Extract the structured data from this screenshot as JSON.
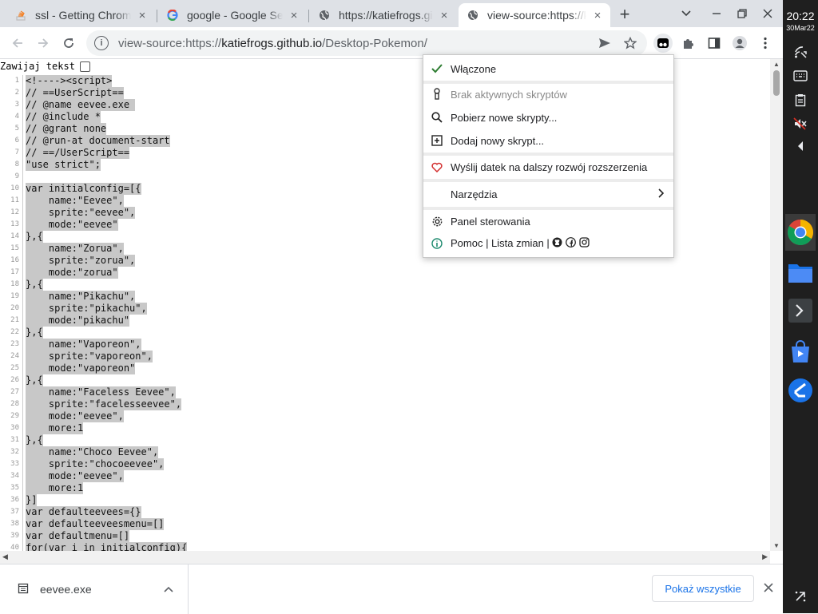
{
  "tabs": [
    {
      "title": "ssl - Getting Chrome",
      "favicon": "stack-icon"
    },
    {
      "title": "google - Google Sear",
      "favicon": "google-icon"
    },
    {
      "title": "https://katiefrogs.git",
      "favicon": "globe-icon"
    },
    {
      "title": "view-source:https://k",
      "favicon": "globe-icon"
    }
  ],
  "omnibox": {
    "scheme": "view-source:https://",
    "host": "katiefrogs.github.io",
    "path": "/Desktop-Pokemon/"
  },
  "wrap_label": "Zawijaj tekst",
  "code_lines": [
    {
      "n": "1",
      "t": "<!----><script>"
    },
    {
      "n": "2",
      "t": "// ==UserScript=="
    },
    {
      "n": "3",
      "t": "// @name eevee.exe "
    },
    {
      "n": "4",
      "t": "// @include *"
    },
    {
      "n": "5",
      "t": "// @grant none"
    },
    {
      "n": "6",
      "t": "// @run-at document-start"
    },
    {
      "n": "7",
      "t": "// ==/UserScript=="
    },
    {
      "n": "8",
      "t": "\"use strict\";"
    },
    {
      "n": "9",
      "t": ""
    },
    {
      "n": "10",
      "t": "var initialconfig=[{"
    },
    {
      "n": "11",
      "t": "    name:\"Eevee\","
    },
    {
      "n": "12",
      "t": "    sprite:\"eevee\","
    },
    {
      "n": "13",
      "t": "    mode:\"eevee\""
    },
    {
      "n": "14",
      "t": "},{"
    },
    {
      "n": "15",
      "t": "    name:\"Zorua\","
    },
    {
      "n": "16",
      "t": "    sprite:\"zorua\","
    },
    {
      "n": "17",
      "t": "    mode:\"zorua\""
    },
    {
      "n": "18",
      "t": "},{"
    },
    {
      "n": "19",
      "t": "    name:\"Pikachu\","
    },
    {
      "n": "20",
      "t": "    sprite:\"pikachu\","
    },
    {
      "n": "21",
      "t": "    mode:\"pikachu\""
    },
    {
      "n": "22",
      "t": "},{"
    },
    {
      "n": "23",
      "t": "    name:\"Vaporeon\","
    },
    {
      "n": "24",
      "t": "    sprite:\"vaporeon\","
    },
    {
      "n": "25",
      "t": "    mode:\"vaporeon\""
    },
    {
      "n": "26",
      "t": "},{"
    },
    {
      "n": "27",
      "t": "    name:\"Faceless Eevee\","
    },
    {
      "n": "28",
      "t": "    sprite:\"facelesseevee\","
    },
    {
      "n": "29",
      "t": "    mode:\"eevee\","
    },
    {
      "n": "30",
      "t": "    more:1"
    },
    {
      "n": "31",
      "t": "},{"
    },
    {
      "n": "32",
      "t": "    name:\"Choco Eevee\","
    },
    {
      "n": "33",
      "t": "    sprite:\"chocoeevee\","
    },
    {
      "n": "34",
      "t": "    mode:\"eevee\","
    },
    {
      "n": "35",
      "t": "    more:1"
    },
    {
      "n": "36",
      "t": "}]"
    },
    {
      "n": "37",
      "t": "var defaulteevees={}"
    },
    {
      "n": "38",
      "t": "var defaulteeveesmenu=[]"
    },
    {
      "n": "39",
      "t": "var defaultmenu=[]"
    },
    {
      "n": "40",
      "t": "for(var i in initialconfig){"
    }
  ],
  "popup": {
    "enabled": "Włączone",
    "no_scripts": "Brak aktywnych skryptów",
    "get_new": "Pobierz nowe skrypty...",
    "add_new": "Dodaj nowy skrypt...",
    "donate": "Wyślij datek na dalszy rozwój rozszerzenia",
    "tools": "Narzędzia",
    "dashboard": "Panel sterowania",
    "help": "Pomoc | Lista zmian |"
  },
  "downloads": {
    "file_name": "eevee.exe",
    "show_all": "Pokaż wszystkie"
  },
  "shelf": {
    "time": "20:22",
    "date": "30Mar22"
  },
  "colors": {
    "selection": "#c8c8c8",
    "accent": "#1a73e8",
    "shelf": "#1f1f1f"
  }
}
